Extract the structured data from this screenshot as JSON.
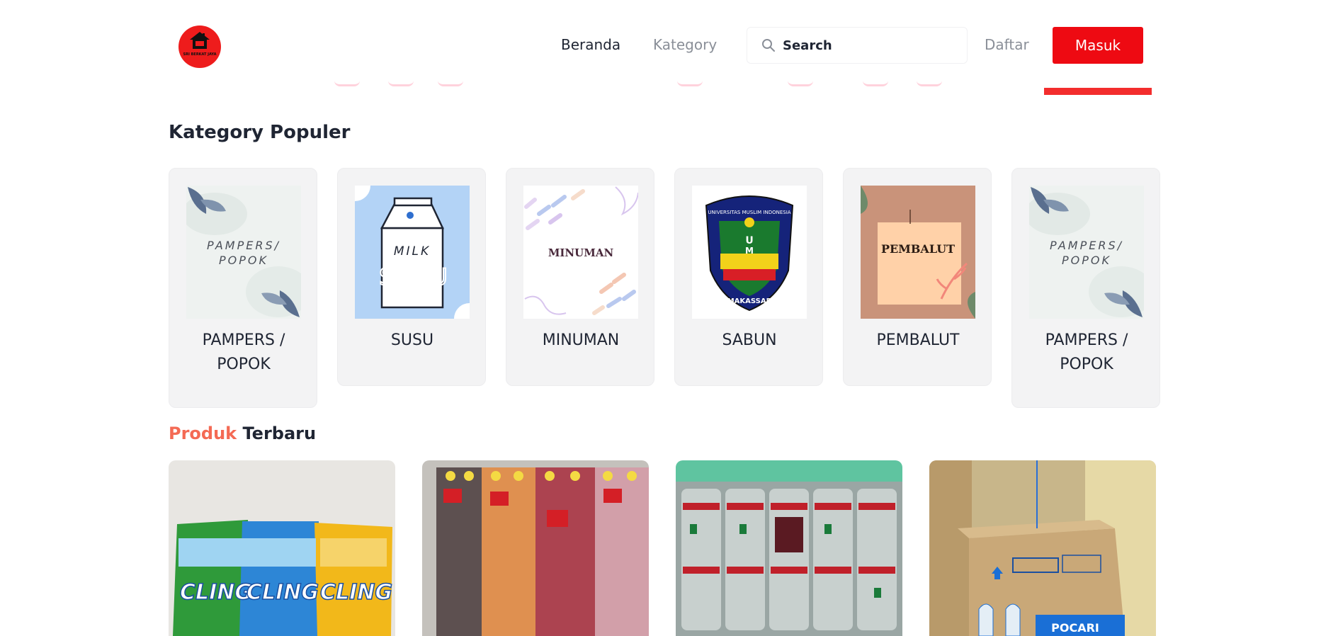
{
  "header": {
    "logo_text": "SRI BERKAT JAYA",
    "nav": {
      "beranda": "Beranda",
      "kategory": "Kategory",
      "daftar": "Daftar"
    },
    "search": {
      "placeholder": "Search",
      "icon": "search-icon"
    },
    "login_label": "Masuk"
  },
  "colors": {
    "accent": "#ee0a12",
    "produk_accent": "#f46a54",
    "card_bg": "#f3f3f4"
  },
  "popular": {
    "title": "Kategory Populer",
    "categories": [
      {
        "label": "PAMPERS / POPOK",
        "image_text": "PAMPERS/ POPOK"
      },
      {
        "label": "SUSU",
        "image_text": "MILK SUSU"
      },
      {
        "label": "MINUMAN",
        "image_text": "MINUMAN"
      },
      {
        "label": "SABUN",
        "image_text": "UNIVERSITAS MUSLIM INDONESIA MAKASSAR"
      },
      {
        "label": "PEMBALUT",
        "image_text": "PEMBALUT"
      },
      {
        "label": "PAMPERS / POPOK",
        "image_text": "PAMPERS/ POPOK"
      }
    ]
  },
  "products": {
    "title_accent": "Produk",
    "title_rest": "Terbaru",
    "items": [
      {
        "image": "cling-detergent-pouches"
      },
      {
        "image": "big-cola-bottle-packs"
      },
      {
        "image": "coca-cola-bottle-packs"
      },
      {
        "image": "pocari-sweat-box"
      }
    ]
  }
}
